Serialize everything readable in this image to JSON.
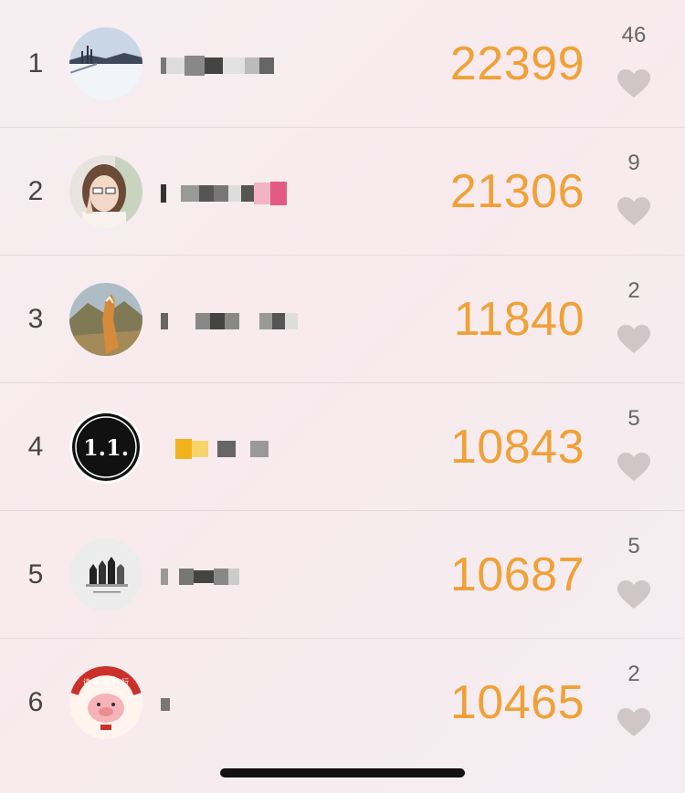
{
  "leaderboard": {
    "rows": [
      {
        "rank": "1",
        "score": "22399",
        "likes": "46",
        "name": "",
        "avatar": "snow-landscape-avatar"
      },
      {
        "rank": "2",
        "score": "21306",
        "likes": "9",
        "name": "",
        "avatar": "girl-selfie-avatar"
      },
      {
        "rank": "3",
        "score": "11840",
        "likes": "2",
        "name": "",
        "avatar": "cat-hills-avatar"
      },
      {
        "rank": "4",
        "score": "10843",
        "likes": "5",
        "name": "",
        "avatar": "1l-logo-avatar",
        "avatar_text": "1.1."
      },
      {
        "rank": "5",
        "score": "10687",
        "likes": "5",
        "name": "",
        "avatar": "chess-pieces-avatar"
      },
      {
        "rank": "6",
        "score": "10465",
        "likes": "2",
        "name": "",
        "avatar": "pig-cartoon-avatar",
        "avatar_text": "读 事 喵 料 行"
      }
    ]
  },
  "colors": {
    "score": "#f0a137",
    "heart": "#d0c6c8",
    "rank": "#444444"
  },
  "icons": {
    "like": "heart-icon"
  }
}
